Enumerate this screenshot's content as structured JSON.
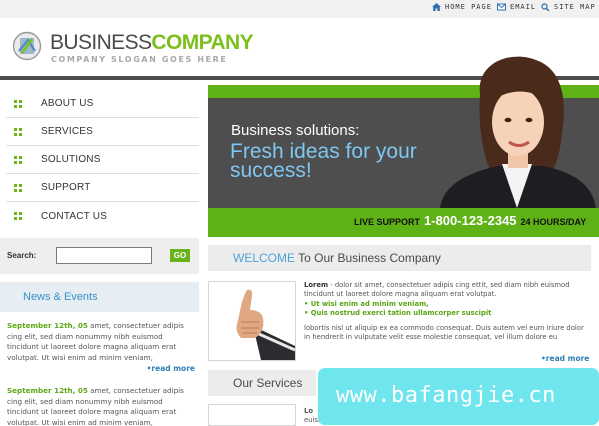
{
  "top_links": [
    {
      "label": "HOME PAGE",
      "icon": "home-icon"
    },
    {
      "label": "EMAIL",
      "icon": "mail-icon"
    },
    {
      "label": "SITE MAP",
      "icon": "sitemap-icon"
    }
  ],
  "logo": {
    "title_part1": "BUSINESS",
    "title_part2": "COMPANY",
    "slogan": "COMPANY SLOGAN GOES HERE"
  },
  "nav": [
    "ABOUT US",
    "SERVICES",
    "SOLUTIONS",
    "SUPPORT",
    "CONTACT US"
  ],
  "search": {
    "label": "Search:",
    "value": "",
    "button": "GO"
  },
  "news": {
    "title": "News & Events",
    "items": [
      {
        "date": "September 12th, 05",
        "text": " amet, consectetuer adipis cing elit, sed diam nonummy nibh euismod tincidunt ut laoreet dolore magna aliquam erat volutpat. Ut wisi enim ad minim veniam,",
        "more": "read more"
      },
      {
        "date": "September 12th, 05",
        "text": " amet, consectetuer adipis cing elit, sed diam nonummy nibh euismod tincidunt ut laoreet dolore magna aliquam erat volutpat. Ut wisi enim ad minim veniam,"
      }
    ]
  },
  "banner": {
    "line1": "Business solutions:",
    "line2": "Fresh ideas for your success!",
    "support_label": "LIVE SUPPORT",
    "phone": "1-800-123-2345",
    "hours": "24 HOURS/DAY"
  },
  "welcome": {
    "highlight": "WELCOME",
    "rest": " To Our Business Company",
    "lead": "Lorem",
    "p1": " - dolor sit amet, consectetuer adipis cing ettit, sed diam nibh euismod tincidunt ut laoreet dolore magna aliquam erat volutpat.",
    "bullet1": "• Ut wisi enim ad minim veniam,",
    "bullet2": "• Quis nostrud exerci tation ullamcorper suscipit",
    "p2": "lobortis nisl ut aliquip ex ea commodo consequat. Duis autem vel eum iriure dolor in hendrerit in vulputate velit esse molestie consequat, vel illum dolore eu",
    "more": "read more"
  },
  "services": {
    "title": "Our Services",
    "lead": "Lo",
    "text": "euismo"
  },
  "watermark": "www.bafangjie.cn",
  "colors": {
    "accent_green": "#5fb216",
    "accent_blue": "#4ea3dd",
    "banner_dark": "#4e4e4e",
    "watermark": "#6fe6ee"
  }
}
